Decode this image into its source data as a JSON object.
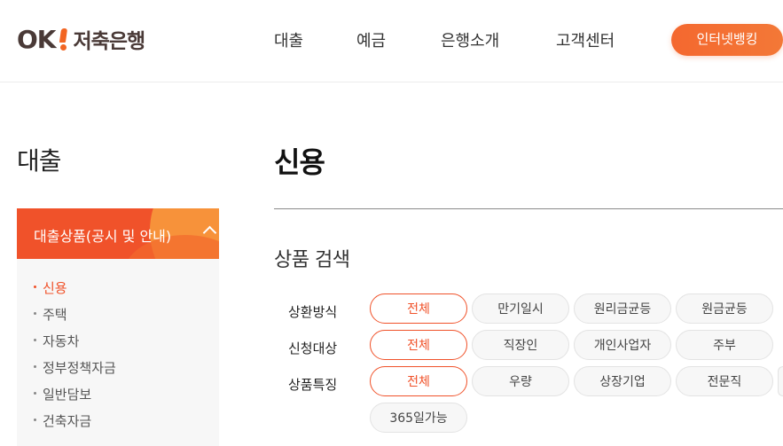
{
  "header": {
    "logo": {
      "ok": "OK",
      "text": "저축은행"
    },
    "nav": [
      "대출",
      "예금",
      "은행소개",
      "고객센터"
    ],
    "internet_banking": "인터넷뱅킹"
  },
  "sidebar": {
    "title": "대출",
    "category": "대출상품(공시 및 안내)",
    "items": [
      {
        "label": "신용",
        "active": true
      },
      {
        "label": "주택",
        "active": false
      },
      {
        "label": "자동차",
        "active": false
      },
      {
        "label": "정부정책자금",
        "active": false
      },
      {
        "label": "일반담보",
        "active": false
      },
      {
        "label": "건축자금",
        "active": false
      }
    ]
  },
  "main": {
    "title": "신용",
    "section_title": "상품 검색",
    "filters": [
      {
        "label": "상환방식",
        "options": [
          "전체",
          "만기일시",
          "원리금균등",
          "원금균등"
        ],
        "selected": "전체"
      },
      {
        "label": "신청대상",
        "options": [
          "전체",
          "직장인",
          "개인사업자",
          "주부"
        ],
        "selected": "전체"
      },
      {
        "label": "상품특징",
        "options": [
          "전체",
          "우량",
          "상장기업",
          "전문직",
          "365일가능"
        ],
        "selected": "전체"
      }
    ]
  },
  "colors": {
    "accent": "#f0522a",
    "accent_light": "#f7923a",
    "logo_dark": "#4a3a37"
  }
}
